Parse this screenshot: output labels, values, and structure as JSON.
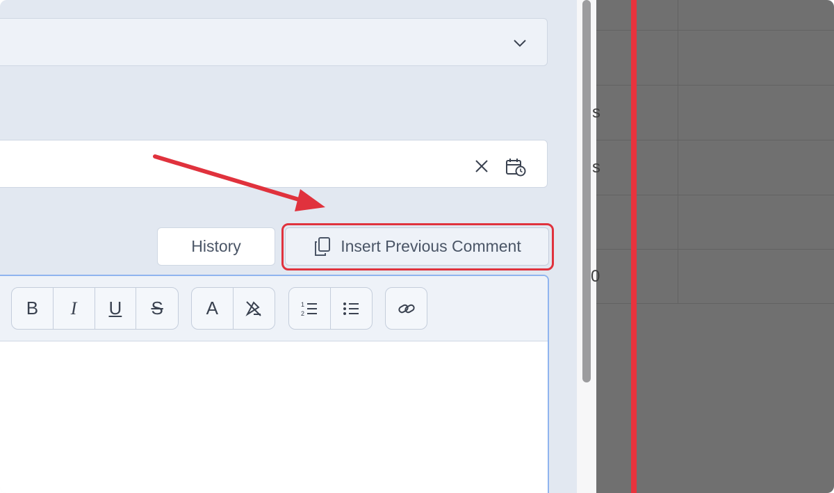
{
  "form": {
    "history_label": "History",
    "insert_label": "Insert Previous Comment"
  },
  "toolbar": {
    "bold": "B",
    "italic": "I",
    "underline": "U",
    "strike": "S",
    "font_color": "A"
  },
  "background_sheet": {
    "cells": [
      "s",
      "s",
      "0"
    ]
  },
  "colors": {
    "annotation_red": "#e0323d",
    "panel_bg": "#e2e8f1",
    "overlay": "#707070"
  },
  "icons": [
    "chevron-down-icon",
    "clear-icon",
    "calendar-clock-icon",
    "copy-icon",
    "font-color-icon",
    "clear-format-icon",
    "ordered-list-icon",
    "bulleted-list-icon",
    "link-icon"
  ]
}
